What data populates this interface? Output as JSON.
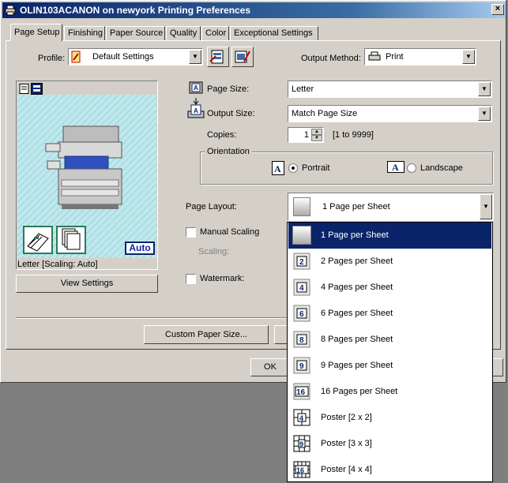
{
  "window": {
    "title": "OLIN103ACANON on newyork Printing Preferences",
    "close_label": "×"
  },
  "tabs": [
    {
      "label": "Page Setup",
      "active": true
    },
    {
      "label": "Finishing"
    },
    {
      "label": "Paper Source"
    },
    {
      "label": "Quality"
    },
    {
      "label": "Color"
    },
    {
      "label": "Exceptional Settings"
    }
  ],
  "profile": {
    "label": "Profile:",
    "value": "Default Settings"
  },
  "output_method": {
    "label": "Output Method:",
    "value": "Print"
  },
  "preview": {
    "badge": "Auto",
    "status": "Letter [Scaling: Auto]",
    "view_settings_label": "View Settings"
  },
  "page_size": {
    "label": "Page Size:",
    "value": "Letter"
  },
  "output_size": {
    "label": "Output Size:",
    "value": "Match Page Size"
  },
  "copies": {
    "label": "Copies:",
    "value": "1",
    "range": "[1 to 9999]"
  },
  "orientation": {
    "group_label": "Orientation",
    "portrait_label": "Portrait",
    "landscape_label": "Landscape",
    "selected": "portrait"
  },
  "page_layout": {
    "label": "Page Layout:",
    "value": "1 Page per Sheet"
  },
  "manual_scaling": {
    "label": "Manual Scaling",
    "checked": false
  },
  "scaling": {
    "label": "Scaling:"
  },
  "watermark": {
    "label": "Watermark:",
    "checked": false
  },
  "buttons": {
    "custom_paper_size": "Custom Paper Size...",
    "ok": "OK"
  },
  "layout_options": [
    {
      "label": "1 Page per Sheet",
      "icon": "",
      "selected": true
    },
    {
      "label": "2 Pages per Sheet",
      "icon": "2"
    },
    {
      "label": "4 Pages per Sheet",
      "icon": "4"
    },
    {
      "label": "6 Pages per Sheet",
      "icon": "6"
    },
    {
      "label": "8 Pages per Sheet",
      "icon": "8"
    },
    {
      "label": "9 Pages per Sheet",
      "icon": "9"
    },
    {
      "label": "16 Pages per Sheet",
      "icon": "16"
    },
    {
      "label": "Poster [2 x 2]",
      "icon": "4"
    },
    {
      "label": "Poster [3 x 3]",
      "icon": "9"
    },
    {
      "label": "Poster [4 x 4]",
      "icon": "16"
    }
  ],
  "colors": {
    "title_start": "#0a246a",
    "title_end": "#a6caf0",
    "selection": "#0a246a",
    "face": "#d4d0c8",
    "preview_bg": "#bfe8ec"
  }
}
